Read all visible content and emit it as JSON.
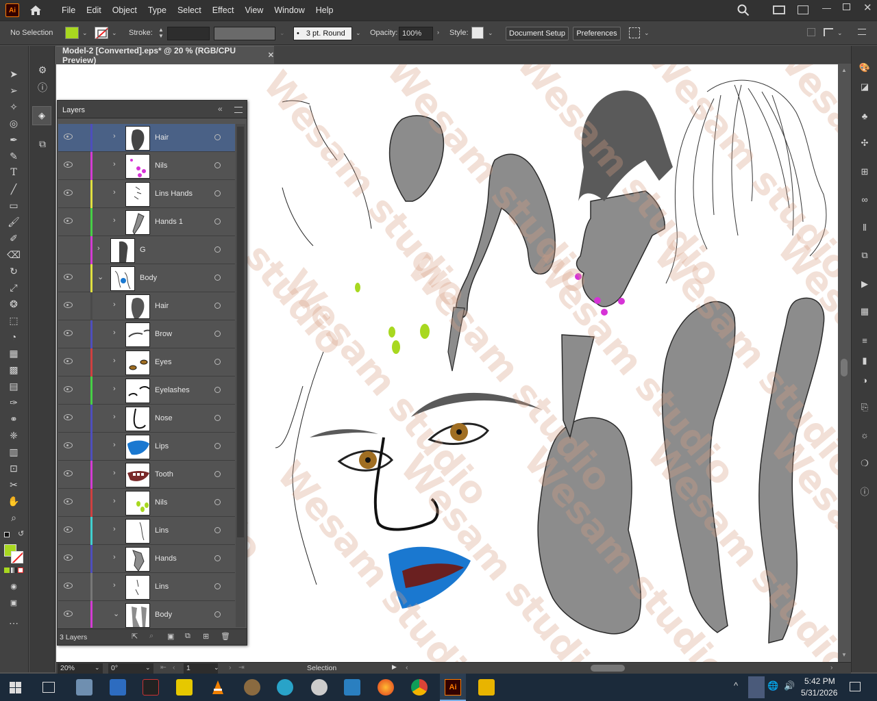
{
  "app": {
    "logo": "Ai"
  },
  "menu": [
    "File",
    "Edit",
    "Object",
    "Type",
    "Select",
    "Effect",
    "View",
    "Window",
    "Help"
  ],
  "control_bar": {
    "selection_state": "No Selection",
    "fill_color": "#a8d820",
    "stroke_label": "Stroke:",
    "brush_value": "3 pt. Round",
    "opacity_label": "Opacity:",
    "opacity_value": "100%",
    "style_label": "Style:",
    "document_setup": "Document Setup",
    "preferences": "Preferences"
  },
  "document": {
    "tab_title": "Model-2 [Converted].eps* @ 20 % (RGB/CPU Preview)",
    "close_glyph": "✕"
  },
  "layers_panel": {
    "title": "Layers",
    "footer_count": "3 Layers",
    "rows": [
      {
        "name": "Hair",
        "color": "#4e4ebd",
        "selected": true,
        "depth": 1
      },
      {
        "name": "Nils",
        "color": "#d43bd4",
        "selected": false,
        "depth": 1
      },
      {
        "name": "Lins Hands",
        "color": "#e0e040",
        "selected": false,
        "depth": 1
      },
      {
        "name": "Hands 1",
        "color": "#46d046",
        "selected": false,
        "depth": 1
      },
      {
        "name": "G",
        "color": "#d43bd4",
        "selected": false,
        "depth": 0
      },
      {
        "name": "Body",
        "color": "#e0e040",
        "selected": false,
        "depth": 0
      },
      {
        "name": "Hair",
        "color": "#4a4a4a",
        "selected": false,
        "depth": 1
      },
      {
        "name": "Brow",
        "color": "#4e4ebd",
        "selected": false,
        "depth": 1
      },
      {
        "name": "Eyes",
        "color": "#d04040",
        "selected": false,
        "depth": 1
      },
      {
        "name": "Eyelashes",
        "color": "#46d046",
        "selected": false,
        "depth": 1
      },
      {
        "name": "Nose",
        "color": "#4e4ebd",
        "selected": false,
        "depth": 1
      },
      {
        "name": "Lips",
        "color": "#4e4ebd",
        "selected": false,
        "depth": 1
      },
      {
        "name": "Tooth",
        "color": "#d43bd4",
        "selected": false,
        "depth": 1
      },
      {
        "name": "Nils",
        "color": "#d04040",
        "selected": false,
        "depth": 1
      },
      {
        "name": "Lins",
        "color": "#40d0d0",
        "selected": false,
        "depth": 1
      },
      {
        "name": "Hands",
        "color": "#4e4ebd",
        "selected": false,
        "depth": 1
      },
      {
        "name": "Lins",
        "color": "#777777",
        "selected": false,
        "depth": 1
      },
      {
        "name": "Body",
        "color": "#d43bd4",
        "selected": false,
        "depth": 1
      }
    ]
  },
  "status_bar": {
    "zoom": "20%",
    "rotation": "0°",
    "artboard": "1",
    "tool": "Selection"
  },
  "watermark": "Wesam studio",
  "taskbar": {
    "time": "5:42 PM",
    "date": "5/31/2026",
    "app_icons": [
      "windows-start",
      "task-view",
      "photos",
      "snipping-tool",
      "studio",
      "player",
      "vlc",
      "gimp",
      "network",
      "paw",
      "app-m",
      "firefox",
      "chrome",
      "illustrator",
      "file-explorer"
    ]
  }
}
